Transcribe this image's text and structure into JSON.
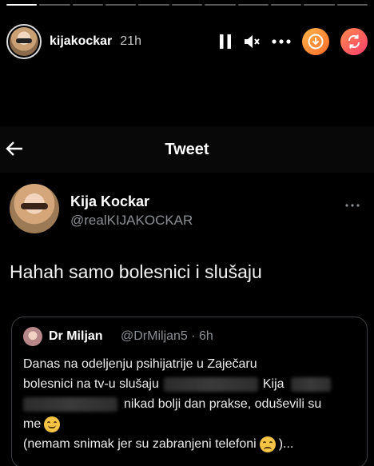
{
  "story": {
    "username": "kijakockar",
    "time": "21h",
    "progress_segments": 11,
    "progress_completed": 1
  },
  "tweet_view": {
    "header_title": "Tweet",
    "author_name": "Kija Kockar",
    "author_handle": "@realKIJAKOCKAR",
    "text": "Hahah samo bolesnici i slušaju",
    "quoted": {
      "author_name": "Dr Miljan",
      "meta": "@DrMiljan5 · 6h",
      "line1": "Danas na odeljenju psihijatrije u Zaječaru",
      "line2_a": "bolesnici na tv-u slušaju",
      "line2_b": "Kija",
      "line3": "nikad bolji dan prakse, oduševili su",
      "line4": "me",
      "line5_a": "(nemam snimak jer su zabranjeni telefoni",
      "line5_b": ")..."
    }
  },
  "colors": {
    "background": "#000000",
    "secondary_text": "#8b8f94",
    "border": "#3b3f44"
  }
}
